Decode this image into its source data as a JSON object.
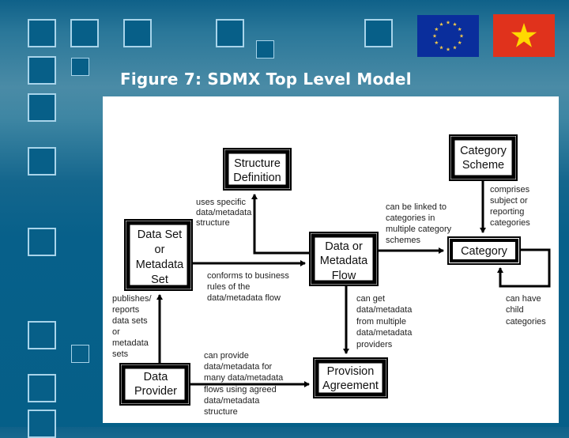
{
  "slide": {
    "title": "Figure 7: SDMX Top Level Model",
    "flags": [
      {
        "name": "European Union",
        "background": "#0a2e9c",
        "star_color": "#f2c94a"
      },
      {
        "name": "Vietnam",
        "background": "#e0321c",
        "star_color": "#ffd900"
      }
    ]
  },
  "diagram": {
    "nodes": {
      "structure_definition": [
        "Structure",
        "Definition"
      ],
      "category_scheme": [
        "Category",
        "Scheme"
      ],
      "dataset": [
        "Data Set",
        "or",
        "Metadata",
        "Set"
      ],
      "dataflow": [
        "Data or",
        "Metadata",
        "Flow"
      ],
      "category": [
        "Category"
      ],
      "data_provider": [
        "Data",
        "Provider"
      ],
      "provision_agreement": [
        "Provision",
        "Agreement"
      ]
    },
    "relations": {
      "uses_structure": [
        "uses specific",
        "data/metadata",
        "structure"
      ],
      "conforms_to": [
        "conforms to business",
        "rules of the",
        "data/metadata flow"
      ],
      "linked_categories": [
        "can be linked to",
        "categories in",
        "multiple category",
        "schemes"
      ],
      "comprises": [
        "comprises",
        "subject or",
        "reporting",
        "categories"
      ],
      "publishes": [
        "publishes/",
        "reports",
        "data sets",
        "or",
        "metadata",
        "sets"
      ],
      "can_get": [
        "can get",
        "data/metadata",
        "from multiple",
        "data/metadata",
        "providers"
      ],
      "child_categories": [
        "can have",
        "child",
        "categories"
      ],
      "can_provide": [
        "can provide",
        "data/metadata for",
        "many data/metadata",
        "flows using agreed",
        "data/metadata",
        "structure"
      ]
    }
  }
}
